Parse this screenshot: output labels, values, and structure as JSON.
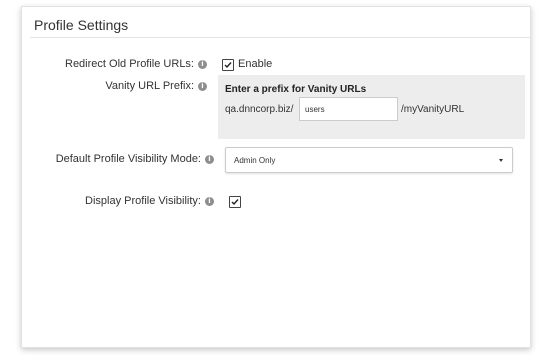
{
  "panel": {
    "title": "Profile Settings"
  },
  "fields": {
    "redirect": {
      "label": "Redirect Old Profile URLs:",
      "checked": true,
      "option_label": "Enable"
    },
    "vanity": {
      "label": "Vanity URL Prefix:",
      "heading": "Enter a prefix for Vanity URLs",
      "domain": "qa.dnncorp.biz/",
      "value": "users",
      "suffix": "/myVanityURL"
    },
    "visibility_mode": {
      "label": "Default Profile Visibility Mode:",
      "selected": "Admin Only"
    },
    "display_visibility": {
      "label": "Display Profile Visibility:",
      "checked": true
    }
  },
  "icons": {
    "info": "info-icon",
    "check": "checkmark-icon",
    "dropdown": "caret-down-icon"
  }
}
